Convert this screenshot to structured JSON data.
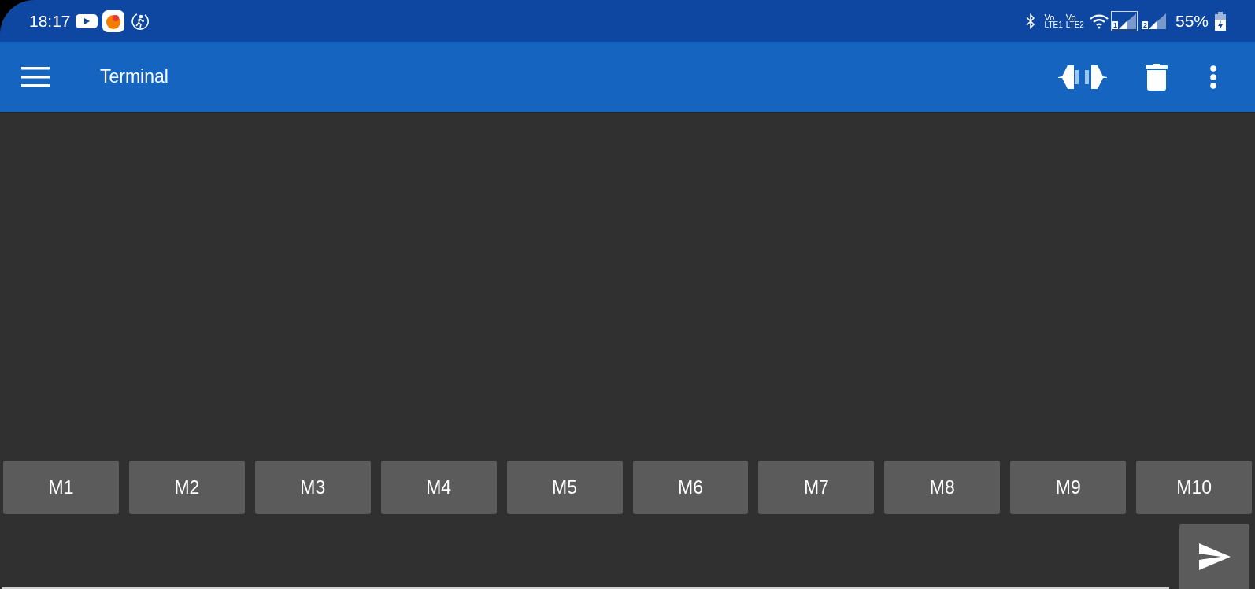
{
  "status_bar": {
    "time": "18:17",
    "volte": [
      {
        "top": "Vo",
        "bottom": "LTE1"
      },
      {
        "top": "Vo",
        "bottom": "LTE2"
      }
    ],
    "sims": [
      {
        "slot": "1",
        "selected": true
      },
      {
        "slot": "2",
        "selected": false
      }
    ],
    "battery": "55%"
  },
  "toolbar": {
    "title": "Terminal"
  },
  "macro_buttons": [
    "M1",
    "M2",
    "M3",
    "M4",
    "M5",
    "M6",
    "M7",
    "M8",
    "M9",
    "M10"
  ]
}
